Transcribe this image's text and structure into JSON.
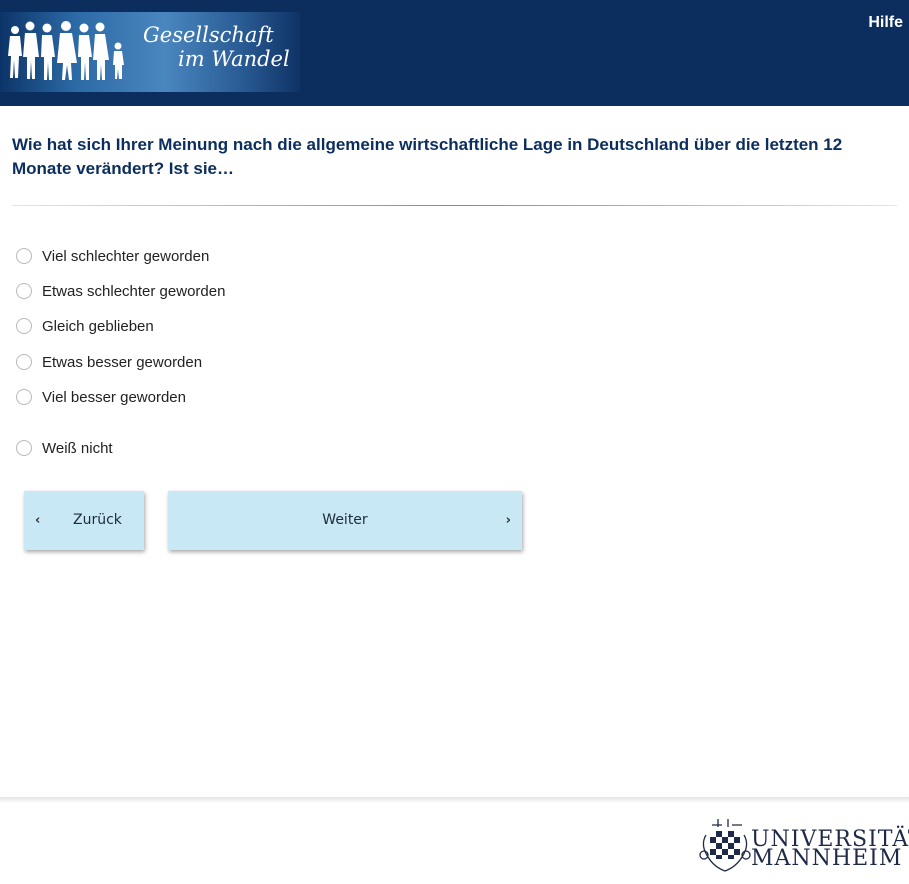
{
  "header": {
    "logo_line1": "Gesellschaft",
    "logo_line2": "im Wandel",
    "help_label": "Hilfe",
    "background_color": "#0b2e5f"
  },
  "question": {
    "text": "Wie hat sich Ihrer Meinung nach die allgemeine wirtschaftliche Lage in Deutschland über die letzten 12 Monate verändert? Ist sie…"
  },
  "options": [
    {
      "label": "Viel schlechter geworden",
      "selected": false
    },
    {
      "label": "Etwas schlechter geworden",
      "selected": false
    },
    {
      "label": "Gleich geblieben",
      "selected": false
    },
    {
      "label": "Etwas besser geworden",
      "selected": false
    },
    {
      "label": "Viel besser geworden",
      "selected": false
    },
    {
      "label": "Weiß nicht",
      "selected": false
    }
  ],
  "navigation": {
    "back_label": "Zurück",
    "next_label": "Weiter",
    "back_icon": "chevron-left-icon",
    "next_icon": "chevron-right-icon",
    "button_color": "#c8e8f5"
  },
  "footer": {
    "university_line1": "UNIVERSITÄT",
    "university_line2": "MANNHEIM"
  }
}
